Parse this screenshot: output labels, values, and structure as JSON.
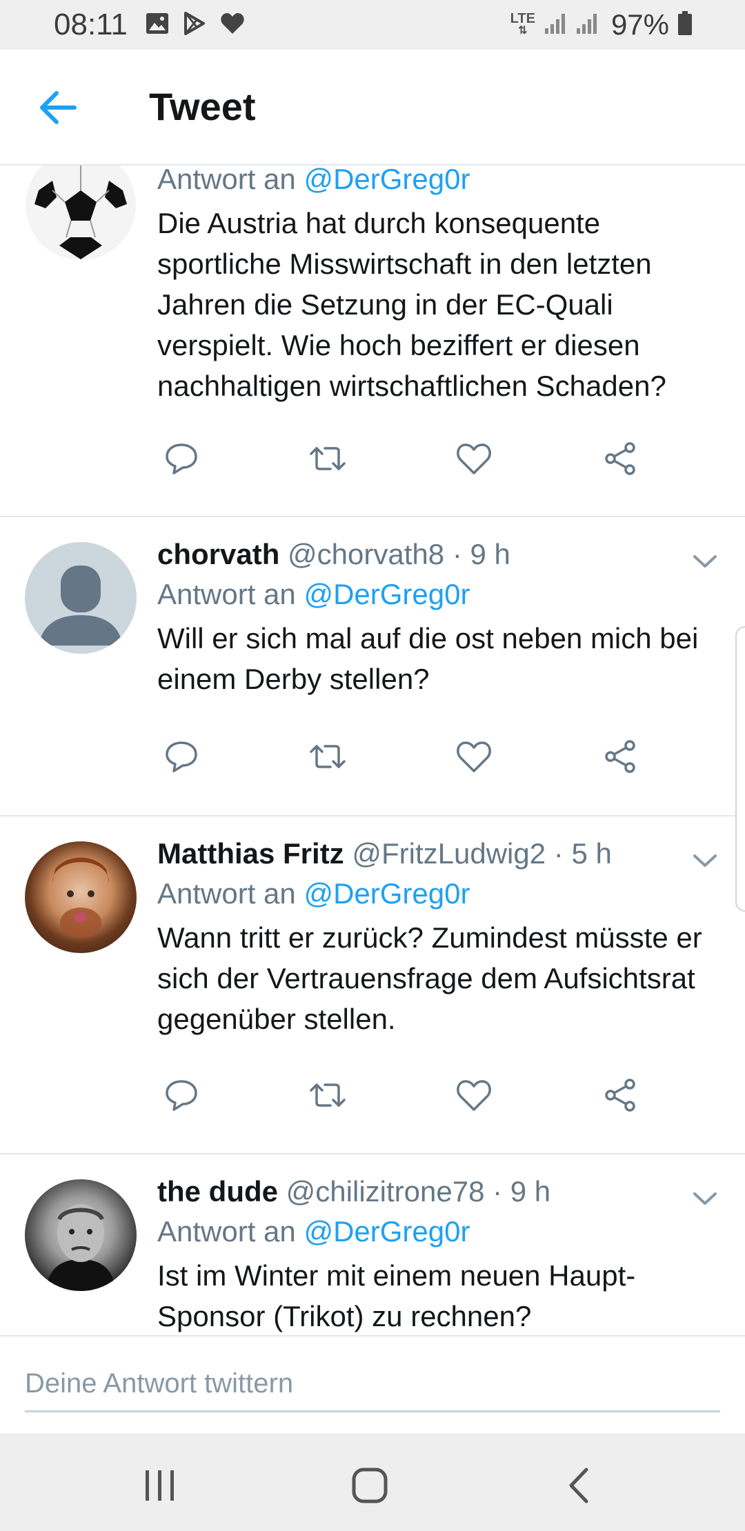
{
  "status_bar": {
    "time": "08:11",
    "network": "LTE",
    "battery": "97%",
    "icons": [
      "image-icon",
      "play-store-icon",
      "heart-icon",
      "signal-icon",
      "battery-icon"
    ]
  },
  "header": {
    "title": "Tweet",
    "back_icon": "arrow-left-icon"
  },
  "colors": {
    "accent": "#1da1f2",
    "text": "#14171a",
    "muted": "#657786",
    "divider": "#e1e8ed"
  },
  "tweets": [
    {
      "avatar": "soccer-ball-avatar",
      "reply_prefix": "Antwort an",
      "reply_to": "@DerGreg0r",
      "text": "Die Austria hat durch konsequente sportliche Misswirtschaft in den letzten Jahren die Setzung in der EC-Quali verspielt. Wie hoch beziffert er diesen nachhaltigen wirtschaftlichen Schaden?"
    },
    {
      "name": "chorvath",
      "handle": "@chorvath8",
      "dot": "·",
      "time": "9 h",
      "avatar": "default-profile-avatar",
      "reply_prefix": "Antwort an",
      "reply_to": "@DerGreg0r",
      "text": "Will er sich mal auf die ost neben mich bei einem Derby stellen?"
    },
    {
      "name": "Matthias Fritz",
      "handle": "@FritzLudwig2",
      "dot": "·",
      "time": "5 h",
      "avatar": "photo-avatar",
      "reply_prefix": "Antwort an",
      "reply_to": "@DerGreg0r",
      "text": "Wann tritt er zurück? Zumindest müsste er sich der Vertrauensfrage dem Aufsichtsrat gegenüber stellen."
    },
    {
      "name": "the dude",
      "handle": "@chilizitrone78",
      "dot": "·",
      "time": "9 h",
      "avatar": "photo-avatar",
      "reply_prefix": "Antwort an",
      "reply_to": "@DerGreg0r",
      "text": "Ist im Winter mit einem neuen Haupt-Sponsor (Trikot) zu rechnen?"
    }
  ],
  "actions": [
    "reply-icon",
    "retweet-icon",
    "like-icon",
    "share-icon"
  ],
  "compose": {
    "placeholder": "Deine Antwort twittern"
  },
  "nav_bar": {
    "icons": [
      "recents-icon",
      "home-icon",
      "back-icon"
    ]
  }
}
